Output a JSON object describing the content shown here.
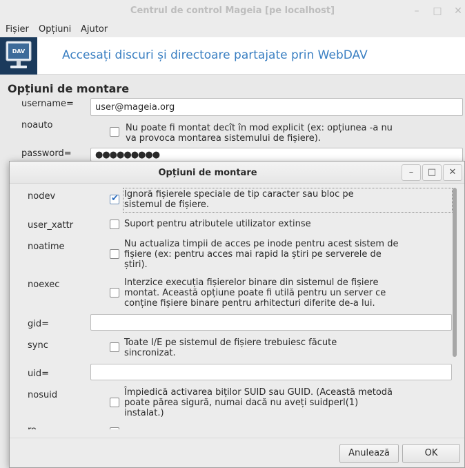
{
  "main_window": {
    "title": "Centrul de control Mageia  [pe localhost]",
    "menu": [
      "Fișier",
      "Opțiuni",
      "Ajutor"
    ],
    "banner_icon_text": "DAV",
    "banner_title": "Accesați discuri și directoare partajate prin WebDAV",
    "section_title": "Opțiuni de montare",
    "username_label": "username=",
    "username_value": "user@mageia.org",
    "noauto_label": "noauto",
    "noauto_desc_line1": "Nu poate fi montat decît în mod explicit (ex: opțiunea -a nu",
    "noauto_desc_line2": "va provoca montarea sistemului de fișiere).",
    "password_label": "password=",
    "password_value": "●●●●●●●●●"
  },
  "dialog": {
    "title": "Opțiuni de montare",
    "options": {
      "nodev": {
        "label": "nodev",
        "checked": true,
        "desc": [
          "Ignoră fișierele speciale de tip caracter sau bloc pe",
          "sistemul de fișiere."
        ]
      },
      "user_xattr": {
        "label": "user_xattr",
        "checked": false,
        "desc": [
          "Suport pentru atributele utilizator extinse"
        ]
      },
      "noatime": {
        "label": "noatime",
        "checked": false,
        "desc": [
          "Nu actualiza timpii de acces pe inode pentru acest sistem de",
          "fișiere (ex: pentru acces mai rapid la știri pe serverele de",
          "știri)."
        ]
      },
      "noexec": {
        "label": "noexec",
        "checked": false,
        "desc": [
          "Interzice execuția fișierelor binare din sistemul de fișiere",
          "montat. Această opțiune poate fi utilă pentru un server ce",
          "conține fișiere binare pentru arhitecturi diferite de-a lui."
        ]
      },
      "gid": {
        "label": "gid=",
        "value": ""
      },
      "sync": {
        "label": "sync",
        "checked": false,
        "desc": [
          "Toate I/E pe sistemul de fișiere trebuiesc făcute",
          "sincronizat."
        ]
      },
      "uid": {
        "label": "uid=",
        "value": ""
      },
      "nosuid": {
        "label": "nosuid",
        "checked": false,
        "desc": [
          "Împiedică activarea biților SUID sau GUID. (Această metodă",
          "poate părea sigură, numai dacă nu aveți suidperl(1)",
          "instalat.)"
        ]
      },
      "ro": {
        "label": "ro"
      }
    },
    "cancel_label": "Anulează",
    "ok_label": "OK"
  },
  "colors": {
    "accent": "#3a7fc2",
    "check": "#2f6fbf",
    "banner_icon_bg": "#1b3a5c"
  }
}
